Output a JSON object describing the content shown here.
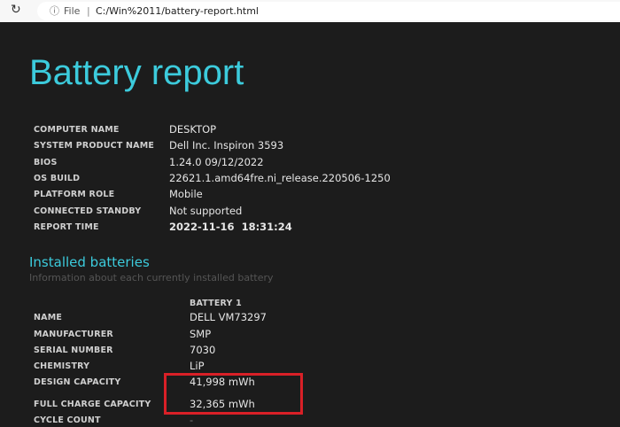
{
  "browser": {
    "file_label": "File",
    "separator": "|",
    "url": "C:/Win%2011/battery-report.html"
  },
  "page_title": "Battery report",
  "system_info": [
    {
      "label": "COMPUTER NAME",
      "value": "DESKTOP"
    },
    {
      "label": "SYSTEM PRODUCT NAME",
      "value": "Dell Inc. Inspiron 3593"
    },
    {
      "label": "BIOS",
      "value": "1.24.0 09/12/2022"
    },
    {
      "label": "OS BUILD",
      "value": "22621.1.amd64fre.ni_release.220506-1250"
    },
    {
      "label": "PLATFORM ROLE",
      "value": "Mobile"
    },
    {
      "label": "CONNECTED STANDBY",
      "value": "Not supported"
    },
    {
      "label": "REPORT TIME",
      "value": "2022-11-16  18:31:24"
    }
  ],
  "installed_batteries": {
    "heading": "Installed batteries",
    "subtitle": "Information about each currently installed battery",
    "column_header": "BATTERY 1",
    "rows": [
      {
        "label": "NAME",
        "value": "DELL VM73297"
      },
      {
        "label": "MANUFACTURER",
        "value": "SMP"
      },
      {
        "label": "SERIAL NUMBER",
        "value": "7030"
      },
      {
        "label": "CHEMISTRY",
        "value": "LiP"
      },
      {
        "label": "DESIGN CAPACITY",
        "value": "41,998 mWh"
      },
      {
        "label": "FULL CHARGE CAPACITY",
        "value": "32,365 mWh"
      },
      {
        "label": "CYCLE COUNT",
        "value": "-"
      }
    ]
  }
}
